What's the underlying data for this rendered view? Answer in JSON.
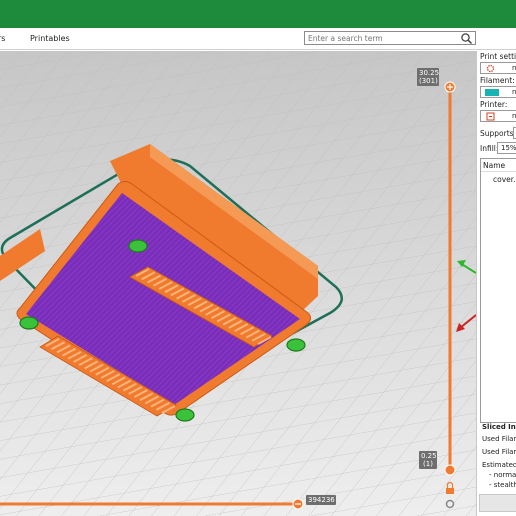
{
  "tabs": [
    {
      "label": "rs"
    },
    {
      "label": "Printables"
    }
  ],
  "search": {
    "placeholder": "Enter a search term"
  },
  "viewport": {
    "layer_slider": {
      "top_value": "30.25",
      "top_layer": "(301)",
      "bottom_value": "0.25",
      "bottom_layer": "(1)"
    },
    "horizontal_slider": {
      "value": "394236"
    }
  },
  "right_panel": {
    "print_settings_label": "Print setting",
    "print_settings_value": "ne",
    "filament_label": "Filament:",
    "filament_value": "ne",
    "filament_color": "#18b4b4",
    "printer_label": "Printer:",
    "printer_value": "ne",
    "supports_label": "Supports:",
    "infill_label": "Infill:",
    "infill_value": "15%",
    "object_list": {
      "header": "Name",
      "items": [
        "cover.ob"
      ]
    },
    "sliced_info": {
      "title": "Sliced Info",
      "used_filament_1": "Used Filam",
      "used_filament_2": "Used Filam",
      "estimated": "Estimated p",
      "normal": "- normal",
      "stealth": "- stealth"
    }
  },
  "colors": {
    "accent_green": "#1e8a3c",
    "model_orange": "#f07a2e",
    "model_purple": "#7a2db8",
    "bed_outline": "#1e6e58",
    "slider_orange": "#f07a2e"
  }
}
